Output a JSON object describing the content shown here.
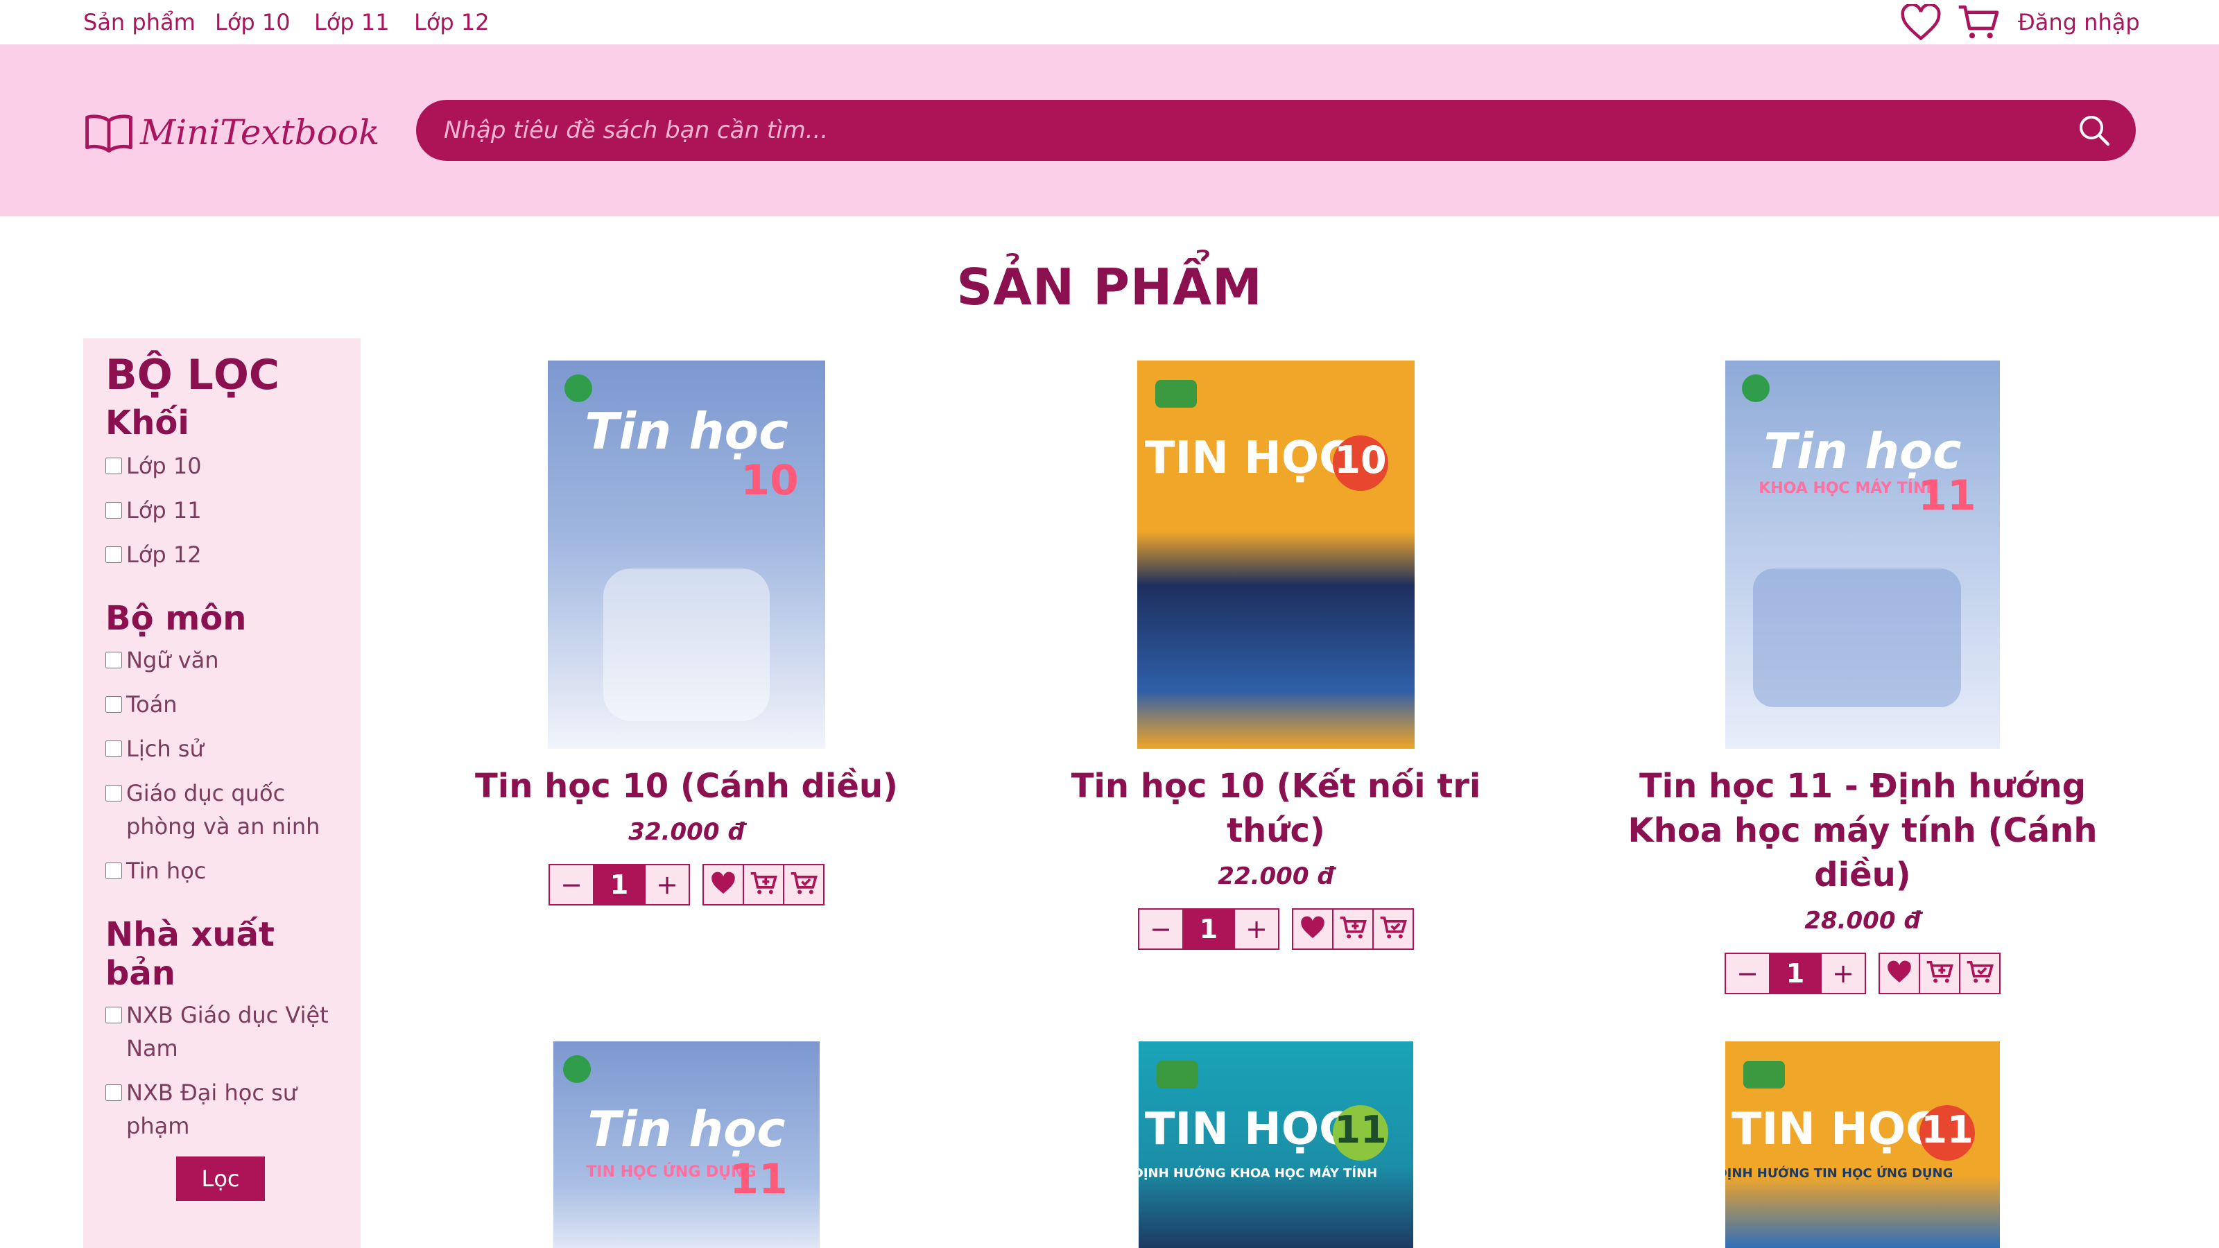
{
  "topnav": {
    "links": [
      "Sản phẩm",
      "Lớp 10",
      "Lớp 11",
      "Lớp 12"
    ],
    "login_label": "Đăng nhập",
    "icons": [
      "heart-icon",
      "cart-icon"
    ]
  },
  "header": {
    "logo_text": "MiniTextbook",
    "search_placeholder": "Nhập tiêu đề sách bạn cần tìm..."
  },
  "page_title": "SẢN PHẨM",
  "sidebar": {
    "title": "BỘ LỌC",
    "groups": [
      {
        "title": "Khối",
        "options": [
          "Lớp 10",
          "Lớp 11",
          "Lớp 12"
        ]
      },
      {
        "title": "Bộ môn",
        "options": [
          "Ngữ văn",
          "Toán",
          "Lịch sử",
          "Giáo dục quốc phòng và an ninh",
          "Tin học"
        ]
      },
      {
        "title": "Nhà xuất bản",
        "options": [
          "NXB Giáo dục Việt Nam",
          "NXB Đại học sư phạm"
        ]
      }
    ],
    "filter_label": "Lọc"
  },
  "products": [
    {
      "name": "Tin học 10 (Cánh diều)",
      "price": "32.000 đ",
      "qty": "1",
      "cover_title": "Tin học",
      "cover_num": "10",
      "cover_sub": ""
    },
    {
      "name": "Tin học 10 (Kết nối tri thức)",
      "price": "22.000 đ",
      "qty": "1",
      "cover_title": "TIN HỌC",
      "cover_num": "10",
      "cover_sub": ""
    },
    {
      "name": "Tin học 11 - Định hướng Khoa học máy tính (Cánh diều)",
      "price": "28.000 đ",
      "qty": "1",
      "cover_title": "Tin học",
      "cover_num": "11",
      "cover_sub": "KHOA HỌC MÁY TÍNH"
    },
    {
      "name": "",
      "price": "",
      "qty": "",
      "cover_title": "Tin học",
      "cover_num": "11",
      "cover_sub": "TIN HỌC ỨNG DỤNG"
    },
    {
      "name": "",
      "price": "",
      "qty": "",
      "cover_title": "TIN HỌC",
      "cover_num": "11",
      "cover_sub": "ĐỊNH HƯỚNG KHOA HỌC MÁY TÍNH"
    },
    {
      "name": "",
      "price": "",
      "qty": "",
      "cover_title": "TIN HỌC",
      "cover_num": "11",
      "cover_sub": "ĐỊNH HƯỚNG TIN HỌC ỨNG DỤNG"
    }
  ],
  "colors": {
    "accent": "#ad1457",
    "header_bg": "#fbcfe8",
    "sidebar_bg": "#fce4ef",
    "text": "#8a1050"
  },
  "control_labels": {
    "minus": "−",
    "plus": "+"
  }
}
